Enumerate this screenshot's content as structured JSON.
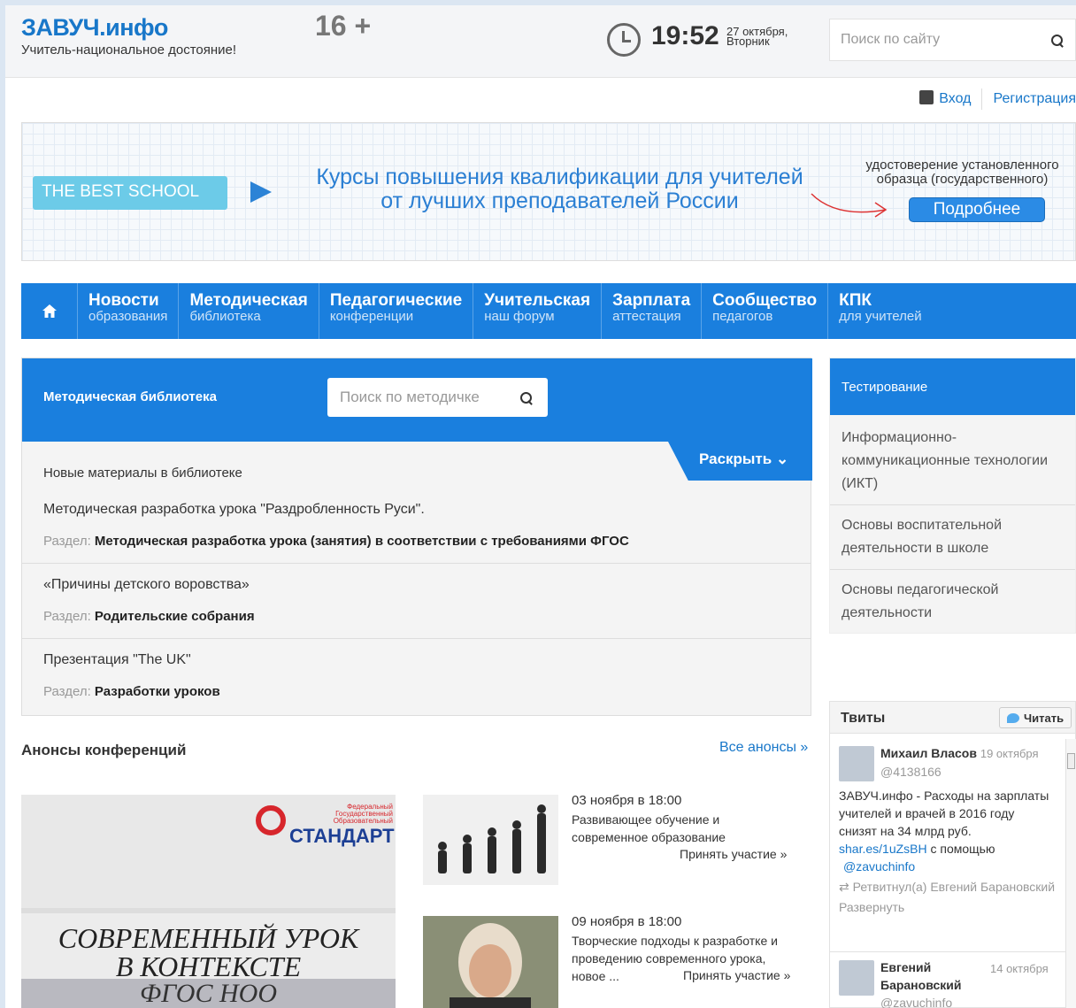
{
  "header": {
    "logo": "ЗАВУЧ.инфо",
    "slogan": "Учитель-национальное достояние!",
    "age_rating": "16 +",
    "time": "19:52",
    "date_line1": "27 октября,",
    "date_line2": "Вторник",
    "search_placeholder": "Поиск по сайту",
    "login": "Вход",
    "register": "Регистрация"
  },
  "banner": {
    "badge": "THE BEST SCHOOL",
    "title_line1": "Курсы повышения квалификации для учителей",
    "title_line2": "от лучших преподавателей России",
    "note_line1": "удостоверение установленного",
    "note_line2": "образца (государственного)",
    "button": "Подробнее"
  },
  "nav": {
    "items": [
      {
        "title": "Новости",
        "sub": "образования"
      },
      {
        "title": "Методическая",
        "sub": "библиотека"
      },
      {
        "title": "Педагогические",
        "sub": "конференции"
      },
      {
        "title": "Учительская",
        "sub": "наш форум"
      },
      {
        "title": "Зарплата",
        "sub": "аттестация"
      },
      {
        "title": "Сообщество",
        "sub": "педагогов"
      },
      {
        "title": "КПК",
        "sub": "для учителей"
      }
    ]
  },
  "library": {
    "title": "Методическая библиотека",
    "search_placeholder": "Поиск по методичке",
    "expand": "Раскрыть",
    "subtitle": "Новые материалы в библиотеке",
    "section_label": "Раздел:",
    "entries": [
      {
        "title": "Методическая разработка урока \"Раздробленность Руси\".",
        "section": "Методическая разработка урока (занятия) в соответствии с требованиями ФГОС"
      },
      {
        "title": "«Причины детского воровства»",
        "section": "Родительские собрания"
      },
      {
        "title": "Презентация \"The UK\"",
        "section": "Разработки уроков"
      }
    ]
  },
  "testing": {
    "title": "Тестирование",
    "items": [
      "Информационно-коммуникационные технологии (ИКТ)",
      "Основы воспитательной деятельности в школе",
      "Основы педагогической деятельности"
    ]
  },
  "conferences": {
    "title": "Анонсы конференций",
    "all_link": "Все анонсы »",
    "poster": {
      "logo_text": "СТАНДАРТ",
      "logo_caption": "Федеральный Государственный Образовательный",
      "line1": "СОВРЕМЕННЫЙ УРОК",
      "line2": "В КОНТЕКСТЕ ТРЕБОВАНИЙ",
      "line3": "ФГОС НОО"
    },
    "events": [
      {
        "date": "03 ноября в 18:00",
        "text": "Развивающее обучение и современное образование",
        "link": "Принять участие »"
      },
      {
        "date": "09 ноября в 18:00",
        "text": "Творческие подходы к разработке и проведению современного урока, новое ...",
        "link": "Принять участие »"
      }
    ]
  },
  "tweets": {
    "title": "Твиты",
    "follow": "Читать",
    "items": [
      {
        "name": "Михаил Власов",
        "date": "19 октября",
        "handle": "@4138166",
        "text": "ЗАВУЧ.инфо - Расходы на зарплаты учителей и врачей в 2016 году снизят на 34 млрд руб.",
        "link": "shar.es/1uZsBH",
        "via": "с помощью",
        "mention": "@zavuchinfo",
        "retweet": "Ретвитнул(а) Евгений Барановский",
        "expand": "Развернуть"
      },
      {
        "name": "Евгений Барановский",
        "date": "14 октября",
        "handle": "@zavuchinfo"
      }
    ]
  }
}
